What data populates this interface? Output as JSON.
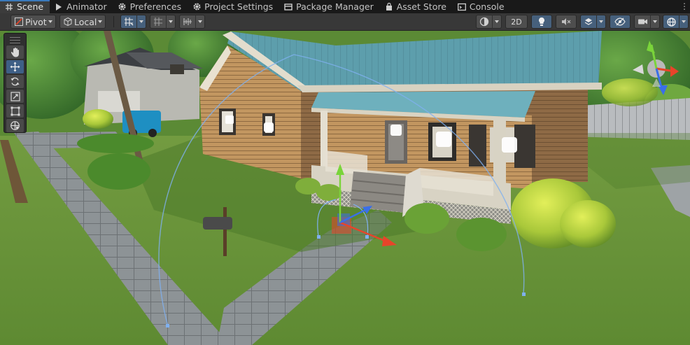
{
  "tabs": [
    {
      "label": "Scene",
      "icon": "grid-icon",
      "active": true
    },
    {
      "label": "Animator",
      "icon": "animator-icon",
      "active": false
    },
    {
      "label": "Preferences",
      "icon": "gear-icon",
      "active": false
    },
    {
      "label": "Project Settings",
      "icon": "gear-icon",
      "active": false
    },
    {
      "label": "Package Manager",
      "icon": "package-icon",
      "active": false
    },
    {
      "label": "Asset Store",
      "icon": "store-icon",
      "active": false
    },
    {
      "label": "Console",
      "icon": "console-icon",
      "active": false
    }
  ],
  "toolbar": {
    "pivot_label": "Pivot",
    "local_label": "Local",
    "mode_2d_label": "2D"
  },
  "tools": [
    {
      "name": "hand-tool",
      "icon": "hand-icon",
      "active": false
    },
    {
      "name": "move-tool",
      "icon": "move-icon",
      "active": true
    },
    {
      "name": "rotate-tool",
      "icon": "rotate-icon",
      "active": false
    },
    {
      "name": "scale-tool",
      "icon": "scale-icon",
      "active": false
    },
    {
      "name": "rect-tool",
      "icon": "rect-icon",
      "active": false
    },
    {
      "name": "transform-tool",
      "icon": "transform-icon",
      "active": false
    }
  ],
  "colors": {
    "accent": "#3a79bb",
    "axis_x": "#e8442a",
    "axis_y": "#7ad43a",
    "axis_z": "#3a6fe8",
    "roof": "#5a9aa8",
    "siding": "#b78a56"
  },
  "gizmo": {
    "projection": "perspective"
  }
}
